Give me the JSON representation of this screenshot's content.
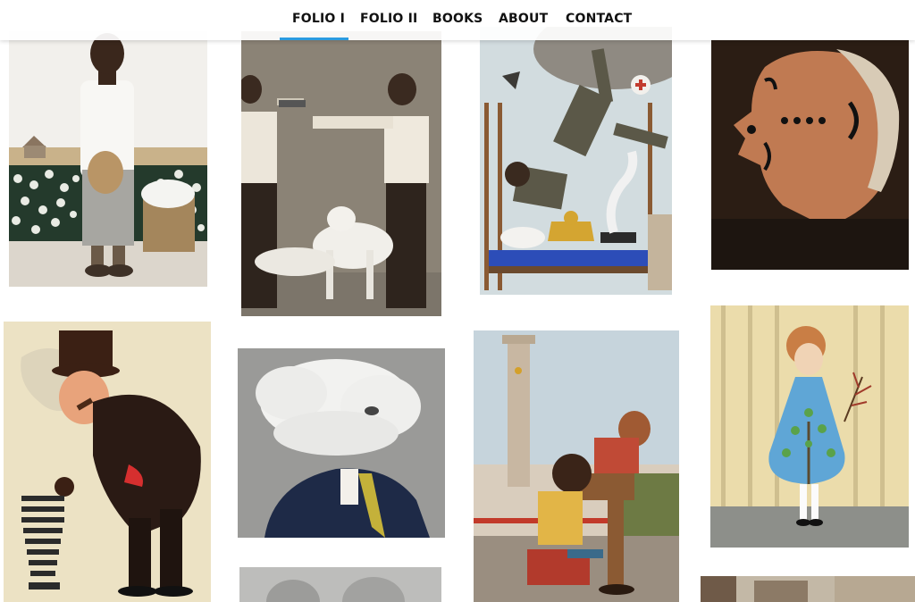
{
  "nav": {
    "items": [
      {
        "label": "FOLIO I",
        "active": true
      },
      {
        "label": "FOLIO II",
        "active": false
      },
      {
        "label": "BOOKS",
        "active": false
      },
      {
        "label": "ABOUT",
        "active": false
      },
      {
        "label": "CONTACT",
        "active": false
      }
    ],
    "active_color": "#2b9be0"
  },
  "gallery": {
    "thumbnails": [
      "farmer-with-hat-cotton-field",
      "men-pointing-guns-white-dog",
      "man-falling-from-zeppelin-over-bed",
      "profile-face-with-punctuation",
      "top-hat-man-smoking-cigar",
      "cloud-head-man-in-suit",
      "couple-sitting-by-tower",
      "girl-in-blue-tree-dress",
      "partial-tile-grey",
      "partial-tile-room"
    ]
  }
}
